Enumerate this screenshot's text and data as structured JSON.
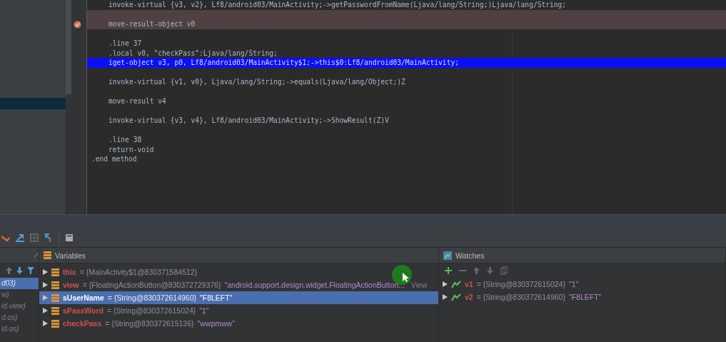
{
  "editor": {
    "lines": [
      {
        "text": "invoke-virtual {v3, v2}, Lf8/android03/MainActivity;->getPasswordFromName(Ljava/lang/String;)Ljava/lang/String;",
        "indent": true,
        "blank_before": false,
        "kind": "normal"
      },
      {
        "text": "move-result-object v0",
        "indent": true,
        "blank_before": true,
        "kind": "breakpoint"
      },
      {
        "text": ".line 37",
        "indent": true,
        "blank_before": true,
        "kind": "normal"
      },
      {
        "text": ".local v0, \"checkPass\":Ljava/lang/String;",
        "indent": true,
        "blank_before": false,
        "kind": "normal"
      },
      {
        "text": "iget-object v3, p0, Lf8/android03/MainActivity$1;->this$0:Lf8/android03/MainActivity;",
        "indent": true,
        "blank_before": false,
        "kind": "current"
      },
      {
        "text": "invoke-virtual {v1, v0}, Ljava/lang/String;->equals(Ljava/lang/Object;)Z",
        "indent": true,
        "blank_before": true,
        "kind": "normal"
      },
      {
        "text": "move-result v4",
        "indent": true,
        "blank_before": true,
        "kind": "normal"
      },
      {
        "text": "invoke-virtual {v3, v4}, Lf8/android03/MainActivity;->ShowResult(Z)V",
        "indent": true,
        "blank_before": true,
        "kind": "normal"
      },
      {
        "text": ".line 38",
        "indent": true,
        "blank_before": true,
        "kind": "normal"
      },
      {
        "text": "return-void",
        "indent": true,
        "blank_before": false,
        "kind": "normal"
      },
      {
        "text": ".end method",
        "indent": false,
        "blank_before": false,
        "kind": "normal"
      }
    ]
  },
  "frames": {
    "items": [
      {
        "text": "d03)",
        "selected": true
      },
      {
        "text": "w)",
        "selected": false
      },
      {
        "text": "id.view)",
        "selected": false
      },
      {
        "text": "d.os)",
        "selected": false
      },
      {
        "text": "id.os)",
        "selected": false
      }
    ]
  },
  "variables": {
    "title": "Variables",
    "rows": [
      {
        "name": "this",
        "value": "= {MainActivity$1@830371584512}",
        "selected": false
      },
      {
        "name": "view",
        "value": "= {FloatingActionButton@830372729376}",
        "string": "\"android.support.design.widget.FloatingActionButton...",
        "link": "View",
        "selected": false
      },
      {
        "name": "sUserName",
        "value": "= {String@830372614960}",
        "string": "\"F8LEFT\"",
        "selected": true
      },
      {
        "name": "sPassWord",
        "value": "= {String@830372615024}",
        "string": "\"1\"",
        "selected": false
      },
      {
        "name": "checkPass",
        "value": "= {String@830372615136}",
        "string": "\"wwpmww\"",
        "selected": false
      }
    ]
  },
  "watches": {
    "title": "Watches",
    "rows": [
      {
        "name": "v1",
        "value": "= {String@830372615024}",
        "string": "\"1\""
      },
      {
        "name": "v2",
        "value": "= {String@830372614960}",
        "string": "\"F8LEFT\""
      }
    ]
  }
}
